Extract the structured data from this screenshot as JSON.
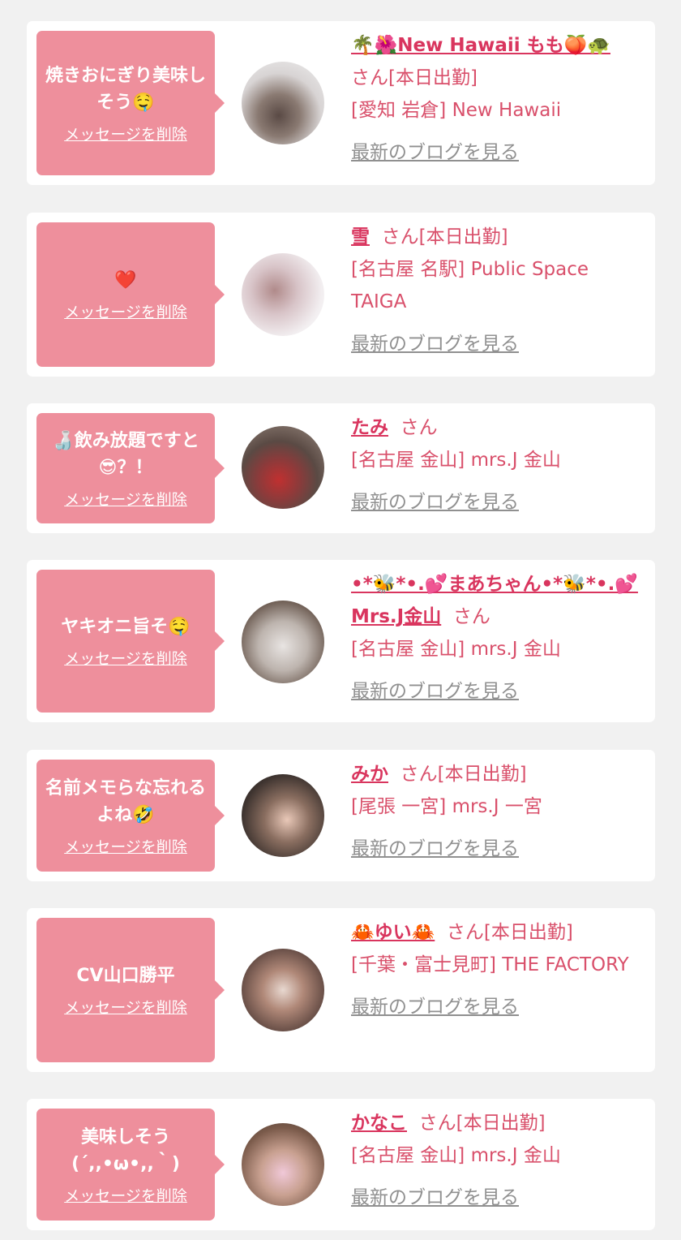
{
  "delete_label": "メッセージを削除",
  "blog_label": "最新のブログを見る",
  "san": "さん",
  "colors": {
    "bubble": "#ee8f9c",
    "accent": "#d9506b",
    "link_gray": "#909090",
    "page_bg": "#f1f1f1"
  },
  "cards": [
    {
      "message": "焼きおにぎり美味しそう🤤",
      "name": "🌴🌺New Hawaii もも🍑🐢",
      "status": "[本日出勤]",
      "shop": "[愛知 岩倉] New Hawaii"
    },
    {
      "message": "❤️",
      "name": "雪",
      "status": "[本日出勤]",
      "shop": "[名古屋 名駅] Public Space TAIGA"
    },
    {
      "message": "🍶飲み放題ですと😎？！",
      "name": "たみ",
      "status": "",
      "shop": "[名古屋 金山] mrs.J 金山"
    },
    {
      "message": "ヤキオニ旨そ🤤",
      "name": "•*🐝*•.💕まあちゃん•*🐝*•.💕Mrs.J金山",
      "status": "",
      "shop": "[名古屋 金山] mrs.J 金山"
    },
    {
      "message": "名前メモらな忘れるよね🤣",
      "name": "みか",
      "status": "[本日出勤]",
      "shop": "[尾張 一宮] mrs.J 一宮"
    },
    {
      "message": "CV山口勝平",
      "name": "🦀ゆい🦀",
      "status": "[本日出勤]",
      "shop": "[千葉・富士見町] THE FACTORY"
    },
    {
      "message": "美味しそう(´,,•ω•,,｀)",
      "name": "かなこ",
      "status": "[本日出勤]",
      "shop": "[名古屋 金山] mrs.J 金山"
    }
  ]
}
